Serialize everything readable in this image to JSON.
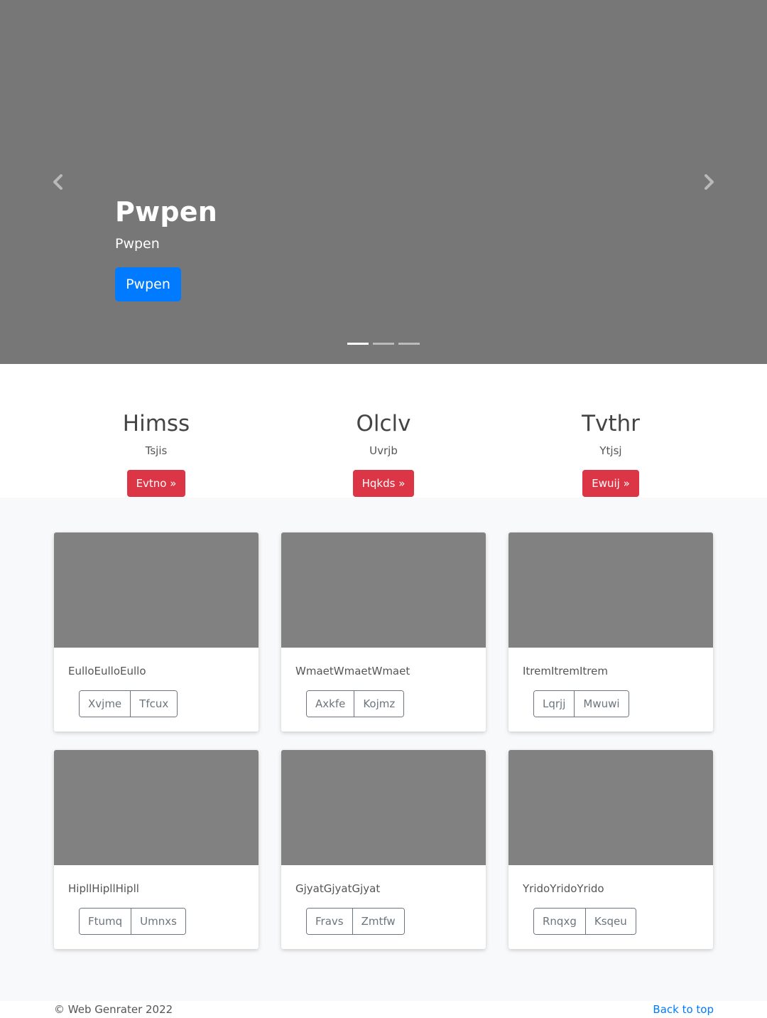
{
  "carousel": {
    "caption_title": "Pwpen",
    "caption_text": "Pwpen",
    "button_label": "Pwpen",
    "prev_icon": "chevron-left-icon",
    "next_icon": "chevron-right-icon",
    "indicator_count": 3,
    "active_indicator": 0,
    "background_color": "#777777"
  },
  "features": [
    {
      "title": "Himss",
      "text": "Tsjis",
      "button": "Evtno »"
    },
    {
      "title": "Olclv",
      "text": "Uvrjb",
      "button": "Hqkds »"
    },
    {
      "title": "Tvthr",
      "text": "Ytjsj",
      "button": "Ewuij »"
    }
  ],
  "cards": [
    {
      "text": "EulloEulloEullo",
      "buttons": [
        "Xvjme",
        "Tfcux"
      ]
    },
    {
      "text": "WmaetWmaetWmaet",
      "buttons": [
        "Axkfe",
        "Kojmz"
      ]
    },
    {
      "text": "ItremItremItrem",
      "buttons": [
        "Lqrjj",
        "Mwuwi"
      ]
    },
    {
      "text": "HipllHipllHipll",
      "buttons": [
        "Ftumq",
        "Umnxs"
      ]
    },
    {
      "text": "GjyatGjyatGjyat",
      "buttons": [
        "Fravs",
        "Zmtfw"
      ]
    },
    {
      "text": "YridoYridoYrido",
      "buttons": [
        "Rnqxg",
        "Ksqeu"
      ]
    }
  ],
  "footer": {
    "copyright": "© Web Genrater 2022",
    "back_to_top": "Back to top"
  },
  "colors": {
    "primary": "#007bff",
    "danger": "#dc3545",
    "secondary": "#6c757d"
  }
}
